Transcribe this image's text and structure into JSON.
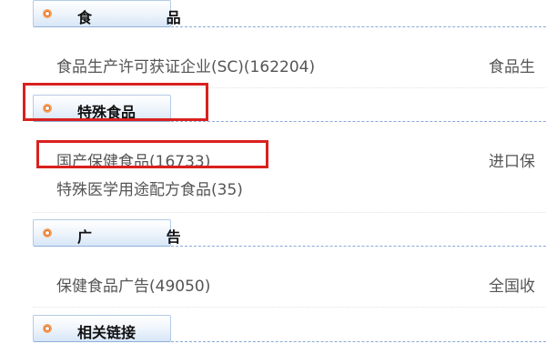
{
  "sections": [
    {
      "title": "食 品",
      "items": [
        {
          "text": "食品生产许可获证企业(SC)(162204)"
        },
        {
          "text": "食品生"
        }
      ]
    },
    {
      "title": "特殊食品",
      "items": [
        {
          "text": "国产保健食品(16733)"
        },
        {
          "text": "进口保"
        },
        {
          "text": "特殊医学用途配方食品(35)"
        }
      ]
    },
    {
      "title": "广 告",
      "items": [
        {
          "text": "保健食品广告(49050)"
        },
        {
          "text": "全国收"
        }
      ]
    },
    {
      "title": "相关链接",
      "items": []
    }
  ],
  "colors": {
    "highlight": "#d9211e",
    "icon": "#e35e16",
    "rule": "#8aa9d8"
  }
}
